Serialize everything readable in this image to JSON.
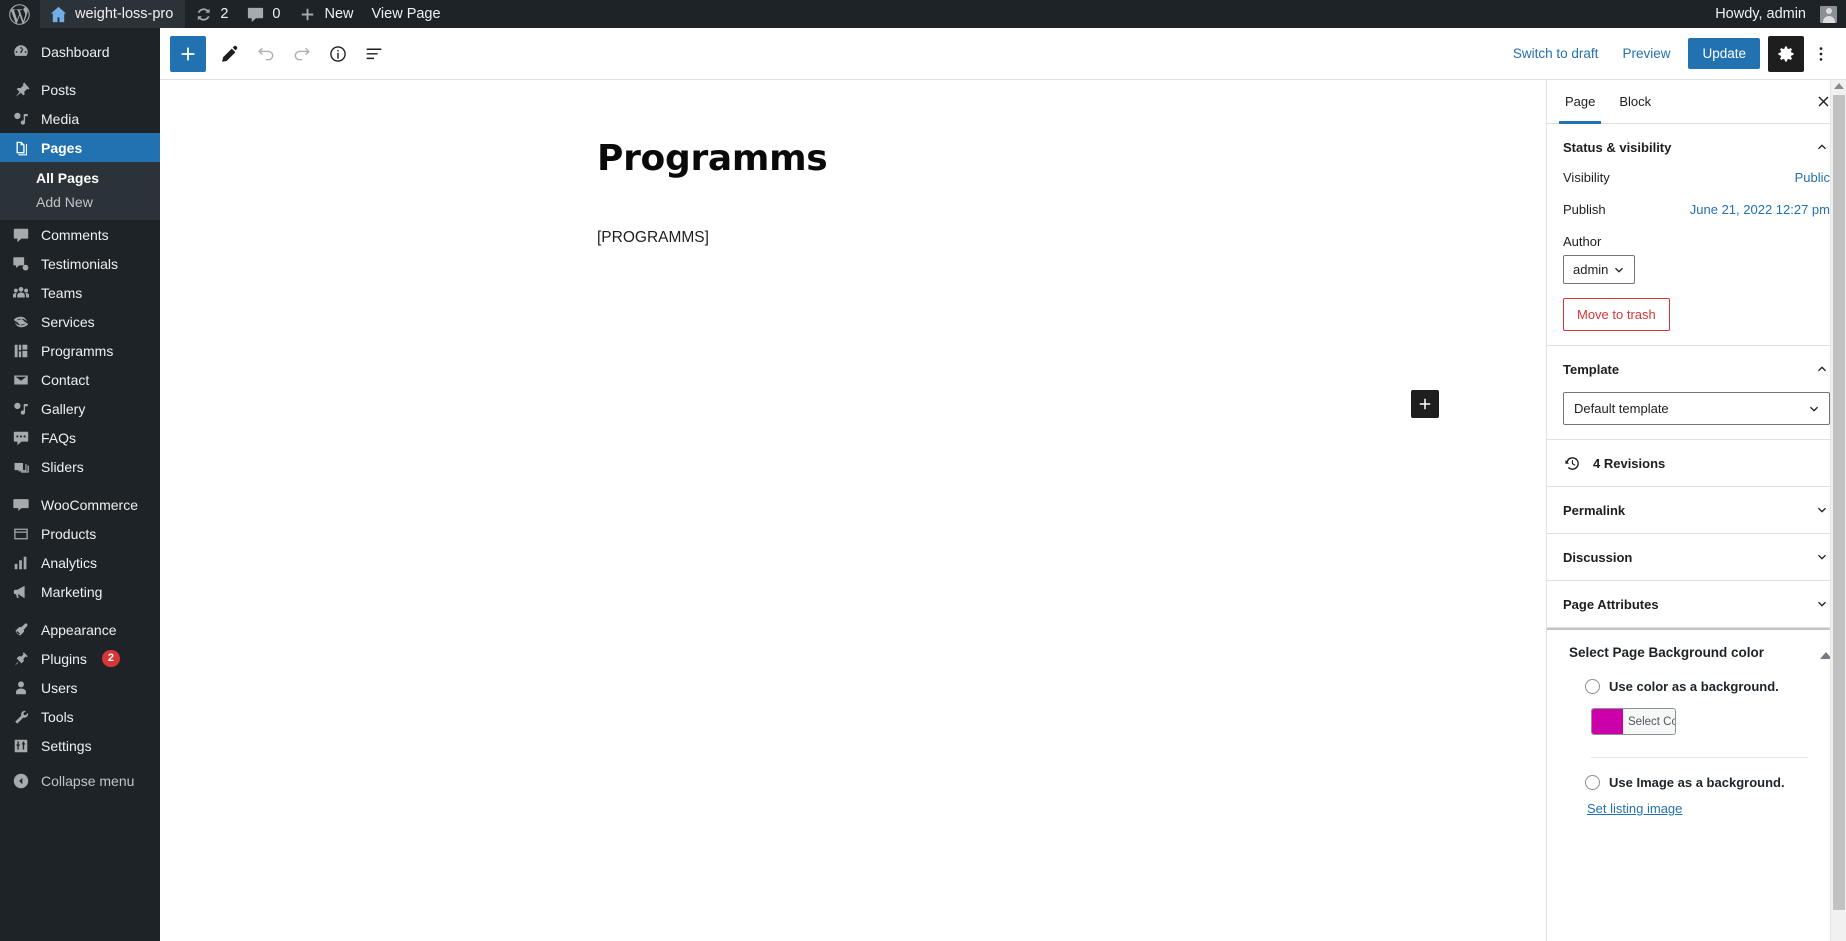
{
  "adminbar": {
    "logo_icon": "wordpress-logo-icon",
    "site_name": "weight-loss-pro",
    "updates_count": "2",
    "comments_count": "0",
    "new_label": "New",
    "view_page_label": "View Page",
    "howdy": "Howdy, admin"
  },
  "sidebar": {
    "items": [
      {
        "label": "Dashboard",
        "icon": "dashboard-icon",
        "current": false
      },
      {
        "label": "Posts",
        "icon": "pin-icon",
        "current": false
      },
      {
        "label": "Media",
        "icon": "media-icon",
        "current": false
      },
      {
        "label": "Pages",
        "icon": "pages-icon",
        "current": true
      },
      {
        "label": "Comments",
        "icon": "comment-icon",
        "current": false
      },
      {
        "label": "Testimonials",
        "icon": "testimonials-icon",
        "current": false
      },
      {
        "label": "Teams",
        "icon": "teams-icon",
        "current": false
      },
      {
        "label": "Services",
        "icon": "services-icon",
        "current": false
      },
      {
        "label": "Programms",
        "icon": "programs-icon",
        "current": false
      },
      {
        "label": "Contact",
        "icon": "envelope-icon",
        "current": false
      },
      {
        "label": "Gallery",
        "icon": "gallery-icon",
        "current": false
      },
      {
        "label": "FAQs",
        "icon": "faq-icon",
        "current": false
      },
      {
        "label": "Sliders",
        "icon": "sliders-icon",
        "current": false
      },
      {
        "label": "WooCommerce",
        "icon": "woocommerce-icon",
        "current": false
      },
      {
        "label": "Products",
        "icon": "products-icon",
        "current": false
      },
      {
        "label": "Analytics",
        "icon": "analytics-icon",
        "current": false
      },
      {
        "label": "Marketing",
        "icon": "marketing-icon",
        "current": false
      },
      {
        "label": "Appearance",
        "icon": "appearance-icon",
        "current": false
      },
      {
        "label": "Plugins",
        "icon": "plugins-icon",
        "current": false,
        "badge": "2"
      },
      {
        "label": "Users",
        "icon": "users-icon",
        "current": false
      },
      {
        "label": "Tools",
        "icon": "tools-icon",
        "current": false
      },
      {
        "label": "Settings",
        "icon": "settings-icon",
        "current": false
      }
    ],
    "submenu": [
      {
        "label": "All Pages",
        "current": true
      },
      {
        "label": "Add New",
        "current": false
      }
    ],
    "collapse_label": "Collapse menu"
  },
  "toolbar": {
    "add_block_icon": "plus-icon",
    "tools_icon": "pencil-icon",
    "undo_icon": "undo-icon",
    "redo_icon": "redo-icon",
    "info_icon": "info-icon",
    "list_view_icon": "list-view-icon",
    "switch_to_draft_label": "Switch to draft",
    "preview_label": "Preview",
    "update_label": "Update",
    "settings_icon": "gear-icon",
    "more_icon": "more-vertical-icon"
  },
  "content": {
    "title": "Programms",
    "paragraph": "[PROGRAMMS]",
    "inserter_icon": "plus-icon"
  },
  "settings": {
    "tabs": [
      {
        "label": "Page",
        "active": true
      },
      {
        "label": "Block",
        "active": false
      }
    ],
    "close_icon": "close-icon",
    "status": {
      "title": "Status & visibility",
      "visibility_label": "Visibility",
      "visibility_value": "Public",
      "publish_label": "Publish",
      "publish_value": "June 21, 2022 12:27 pm",
      "author_label": "Author",
      "author_value": "admin",
      "trash_label": "Move to trash"
    },
    "template": {
      "title": "Template",
      "value": "Default template"
    },
    "revisions": {
      "label": "4 Revisions",
      "icon": "revisions-icon"
    },
    "permalink": {
      "title": "Permalink"
    },
    "discussion": {
      "title": "Discussion"
    },
    "page_attributes": {
      "title": "Page Attributes"
    },
    "background": {
      "title": "Select Page Background color",
      "use_color_label": "Use color as a background.",
      "select_color_label": "Select Color",
      "color_value": "#CC00AA",
      "use_image_label": "Use Image as a background.",
      "set_listing_image_label": "Set listing image"
    }
  },
  "colors": {
    "admin_bar_bg": "#1d2327",
    "menu_bg": "#1d2327",
    "accent_blue": "#2271b1",
    "danger_red": "#d63638",
    "magenta": "#CC00AA"
  }
}
